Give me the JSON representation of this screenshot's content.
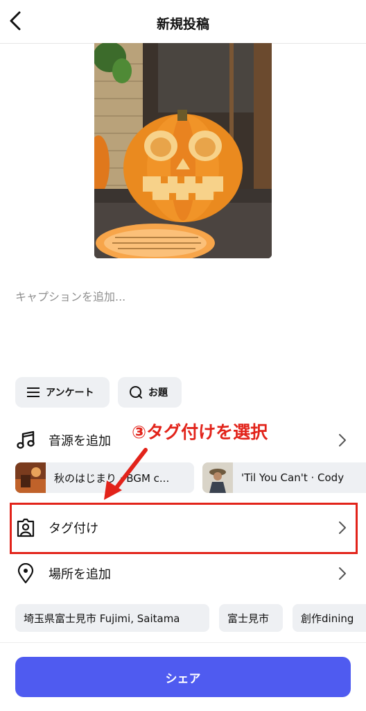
{
  "header": {
    "title": "新規投稿"
  },
  "caption": {
    "placeholder": "キャプションを追加..."
  },
  "chips": {
    "poll": "アンケート",
    "topic": "お題"
  },
  "music": {
    "label": "音源を追加",
    "suggestions": [
      "秋のはじまり · BGM c...",
      "'Til You Can't · Cody"
    ]
  },
  "tag": {
    "label": "タグ付け"
  },
  "location": {
    "label": "場所を追加",
    "suggestions": [
      "埼玉県富士見市 Fujimi, Saitama",
      "富士見市",
      "創作dining"
    ]
  },
  "share_button": "シェア",
  "annotation": {
    "text": "③タグ付けを選択",
    "color": "#e2231a"
  },
  "colors": {
    "accent": "#4f5bf0",
    "chip_bg": "#eef0f3",
    "annotation": "#e2231a"
  },
  "icons": [
    "back-icon",
    "poll-icon",
    "topic-icon",
    "music-note-icon",
    "tag-person-icon",
    "location-pin-icon",
    "chevron-right-icon"
  ]
}
